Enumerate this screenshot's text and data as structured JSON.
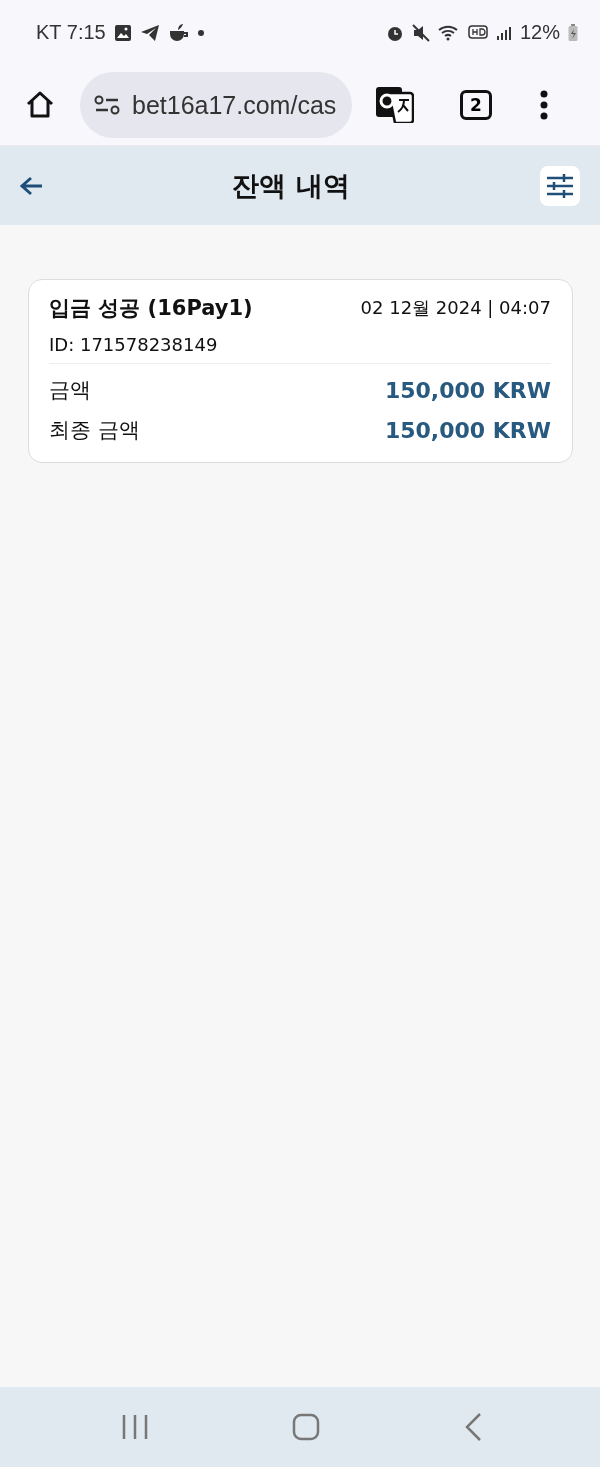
{
  "status_bar": {
    "carrier_time": "KT 7:15",
    "battery": "12%"
  },
  "browser": {
    "url": "bet16a17.com/cas",
    "tab_count": "2"
  },
  "header": {
    "title": "잔액 내역"
  },
  "transactions": [
    {
      "title": "입금 성공 (16Pay1)",
      "datetime": "02 12월 2024 | 04:07",
      "id": "ID: 171578238149",
      "rows": [
        {
          "label": "금액",
          "value": "150,000 KRW"
        },
        {
          "label": "최종 금액",
          "value": "150,000 KRW"
        }
      ]
    }
  ]
}
